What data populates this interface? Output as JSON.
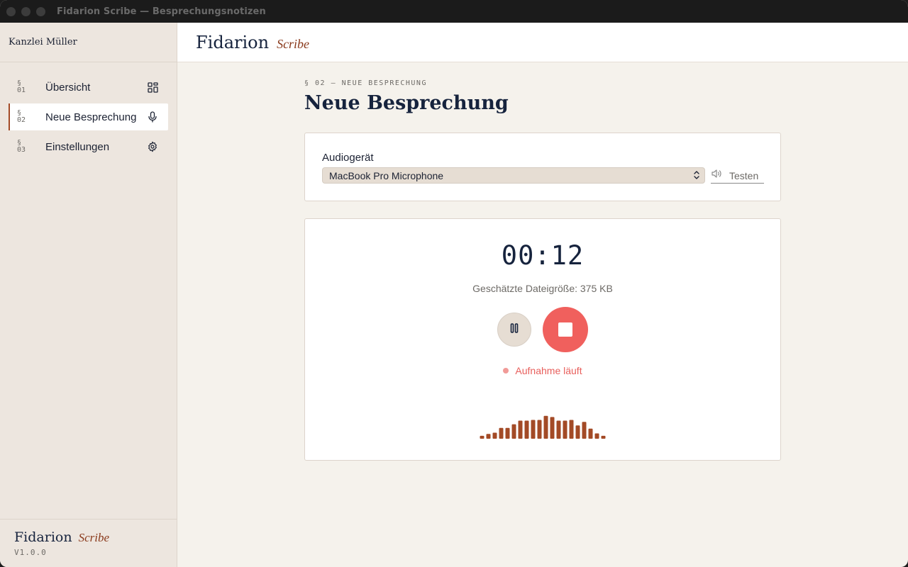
{
  "window": {
    "title": "Fidarion Scribe — Besprechungsnotizen"
  },
  "sidebar": {
    "org": "Kanzlei Müller",
    "items": [
      {
        "section": "§",
        "num": "01",
        "label": "Übersicht",
        "icon": "grid-icon",
        "active": false
      },
      {
        "section": "§",
        "num": "02",
        "label": "Neue Besprechung",
        "icon": "microphone-icon",
        "active": true
      },
      {
        "section": "§",
        "num": "03",
        "label": "Einstellungen",
        "icon": "gear-icon",
        "active": false
      }
    ],
    "footer": {
      "brand": "Fidarion",
      "brand_sub": "Scribe",
      "version": "V1.0.0"
    }
  },
  "header": {
    "brand": "Fidarion",
    "brand_sub": "Scribe"
  },
  "main": {
    "kicker": "§ 02 — NEUE BESPRECHUNG",
    "title": "Neue Besprechung",
    "device": {
      "label": "Audiogerät",
      "selected": "MacBook Pro Microphone",
      "test_label": "Testen",
      "test_icon": "speaker-icon"
    },
    "recording": {
      "timer": "00:12",
      "filesize": "Geschätzte Dateigröße: 375 KB",
      "status": "Aufnahme läuft",
      "pause_icon": "pause-icon",
      "stop_icon": "stop-icon",
      "waveform_levels": [
        0.12,
        0.2,
        0.25,
        0.45,
        0.45,
        0.6,
        0.75,
        0.75,
        0.78,
        0.78,
        0.95,
        0.9,
        0.75,
        0.75,
        0.78,
        0.55,
        0.7,
        0.42,
        0.22,
        0.12
      ]
    }
  },
  "colors": {
    "accent": "#a34a26",
    "record_red": "#f0605d",
    "navy": "#16233d",
    "waveform": "#a34a26"
  }
}
